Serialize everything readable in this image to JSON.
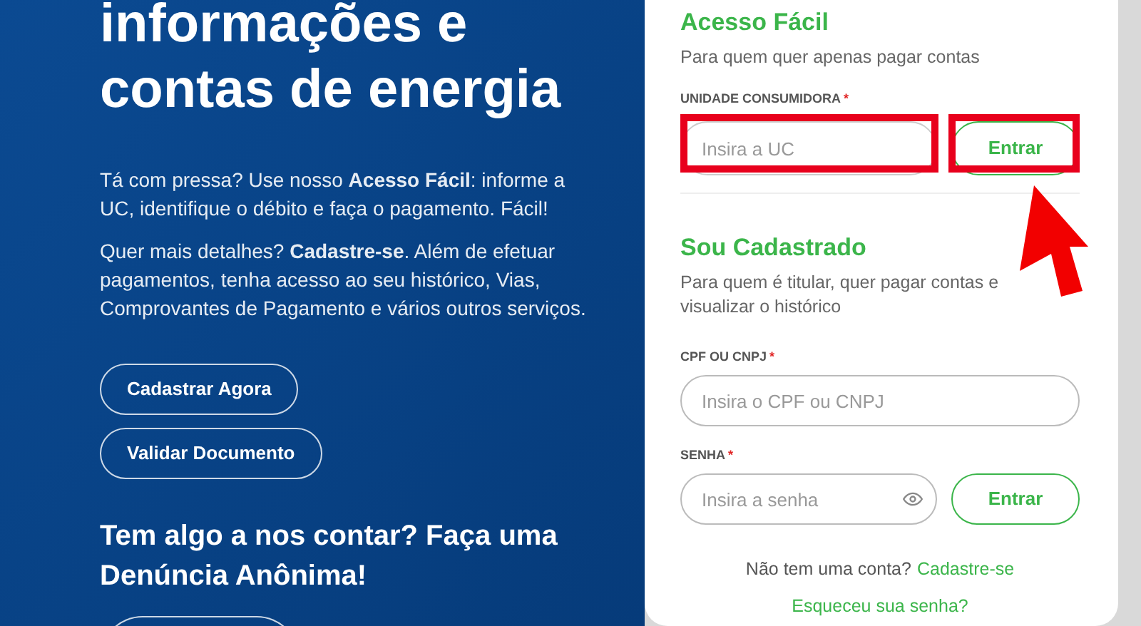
{
  "hero": {
    "title": "informações e contas de energia",
    "paragraphs": [
      "Tá com pressa? Use nosso **Acesso Fácil**: informe a UC, identifique o débito e faça o pagamento. Fácil!",
      "Quer mais detalhes? **Cadastre-se**. Além de efetuar pagamentos, tenha acesso ao seu histórico, Vias, Comprovantes de Pagamento e vários outros serviços."
    ],
    "buttons": [
      "Cadastrar Agora",
      "Validar Documento"
    ],
    "report_title": "Tem algo a nos contar? Faça uma Denúncia Anônima!"
  },
  "quick_access": {
    "title": "Acesso Fácil",
    "subtitle": "Para quem quer apenas pagar contas",
    "field": {
      "label": "UNIDADE CONSUMIDORA",
      "required_mark": "*",
      "placeholder": "Insira a UC"
    },
    "button": "Entrar",
    "highlighted": true
  },
  "registered": {
    "title": "Sou Cadastrado",
    "subtitle": "Para quem é titular, quer pagar contas e visualizar o histórico",
    "fields": [
      {
        "label": "CPF OU CNPJ",
        "required_mark": "*",
        "placeholder": "Insira o CPF ou CNPJ",
        "kind": "text"
      },
      {
        "label": "SENHA",
        "required_mark": "*",
        "placeholder": "Insira a senha",
        "kind": "password"
      }
    ],
    "button": "Entrar",
    "signup_prompt": "Não tem uma conta?",
    "signup_link": "Cadastre-se",
    "forgot_link": "Esqueceu sua senha?"
  }
}
